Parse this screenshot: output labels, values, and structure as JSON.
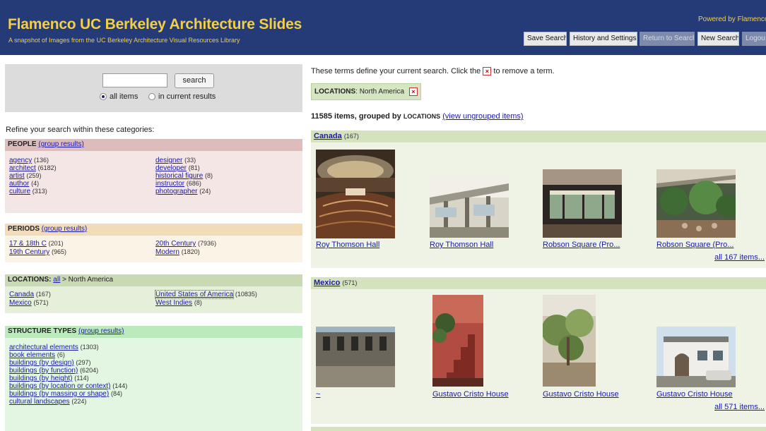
{
  "header": {
    "title": "Flamenco UC Berkeley Architecture Slides",
    "subtitle": "A snapshot of Images from the UC Berkeley Architecture Visual Resources Library",
    "powered_by": "Powered by Flamenco",
    "buttons": {
      "save_search": "Save Search",
      "history_settings": "History and Settings",
      "return_to_search": "Return to Search",
      "new_search": "New Search",
      "logout": "Logout"
    },
    "brand_color": "#243b78",
    "title_color": "#f3cf47"
  },
  "search": {
    "value": "",
    "button": "search",
    "scope_all": "all items",
    "scope_current": "in current results",
    "selected_scope": "all items"
  },
  "refine_label": "Refine your search within these categories:",
  "facets": {
    "people": {
      "title": "PEOPLE",
      "group_link": "(group results)",
      "items": [
        {
          "label": "agency",
          "count": "(136)"
        },
        {
          "label": "architect",
          "count": "(6182)"
        },
        {
          "label": "artist",
          "count": "(259)"
        },
        {
          "label": "author",
          "count": "(4)"
        },
        {
          "label": "culture",
          "count": "(313)"
        },
        {
          "label": "designer",
          "count": "(33)"
        },
        {
          "label": "developer",
          "count": "(81)"
        },
        {
          "label": "historical figure",
          "count": "(8)"
        },
        {
          "label": "instructor",
          "count": "(686)"
        },
        {
          "label": "photographer",
          "count": "(24)"
        }
      ]
    },
    "periods": {
      "title": "PERIODS",
      "group_link": "(group results)",
      "items": [
        {
          "label": "17 & 18th C",
          "count": "(201)"
        },
        {
          "label": "19th Century",
          "count": "(965)"
        },
        {
          "label": "20th Century",
          "count": "(7936)"
        },
        {
          "label": "Modern",
          "count": "(1820)"
        }
      ]
    },
    "locations": {
      "title": "LOCATIONS",
      "all_link": "all",
      "crumb": "> North America",
      "items": [
        {
          "label": "Canada",
          "count": "(167)"
        },
        {
          "label": "Mexico",
          "count": "(571)"
        },
        {
          "label": "United States of America",
          "count": "(10835)"
        },
        {
          "label": "West Indies",
          "count": "(8)"
        }
      ]
    },
    "structure": {
      "title": "STRUCTURE TYPES",
      "group_link": "(group results)",
      "items": [
        {
          "label": "architectural elements",
          "count": "(1303)"
        },
        {
          "label": "book elements",
          "count": "(6)"
        },
        {
          "label": "buildings (by design)",
          "count": "(297)"
        },
        {
          "label": "buildings (by function)",
          "count": "(6204)"
        },
        {
          "label": "buildings (by height)",
          "count": "(114)"
        },
        {
          "label": "buildings (by location or context)",
          "count": "(144)"
        },
        {
          "label": "buildings (by massing or shape)",
          "count": "(84)"
        },
        {
          "label": "cultural landscapes",
          "count": "(224)"
        }
      ]
    }
  },
  "results": {
    "terms_text_before": "These terms define your current search. Click the",
    "terms_text_after": "to remove a term.",
    "remove_symbol": "×",
    "term_label": "LOCATIONS",
    "term_value": ": North America",
    "summary_count": "11585 items, grouped by",
    "summary_group": "LOCATIONS",
    "ungrouped_link": "(view ungrouped items)",
    "groups": [
      {
        "name": "Canada",
        "count": "(167)",
        "captions": [
          "Roy Thomson Hall",
          "Roy Thomson Hall",
          "Robson Square (Pro...",
          "Robson Square (Pro..."
        ],
        "all_link": "all 167 items..."
      },
      {
        "name": "Mexico",
        "count": "(571)",
        "captions": [
          "~",
          "Gustavo Cristo House",
          "Gustavo Cristo House",
          "Gustavo Cristo House"
        ],
        "all_link": "all 571 items..."
      }
    ]
  }
}
